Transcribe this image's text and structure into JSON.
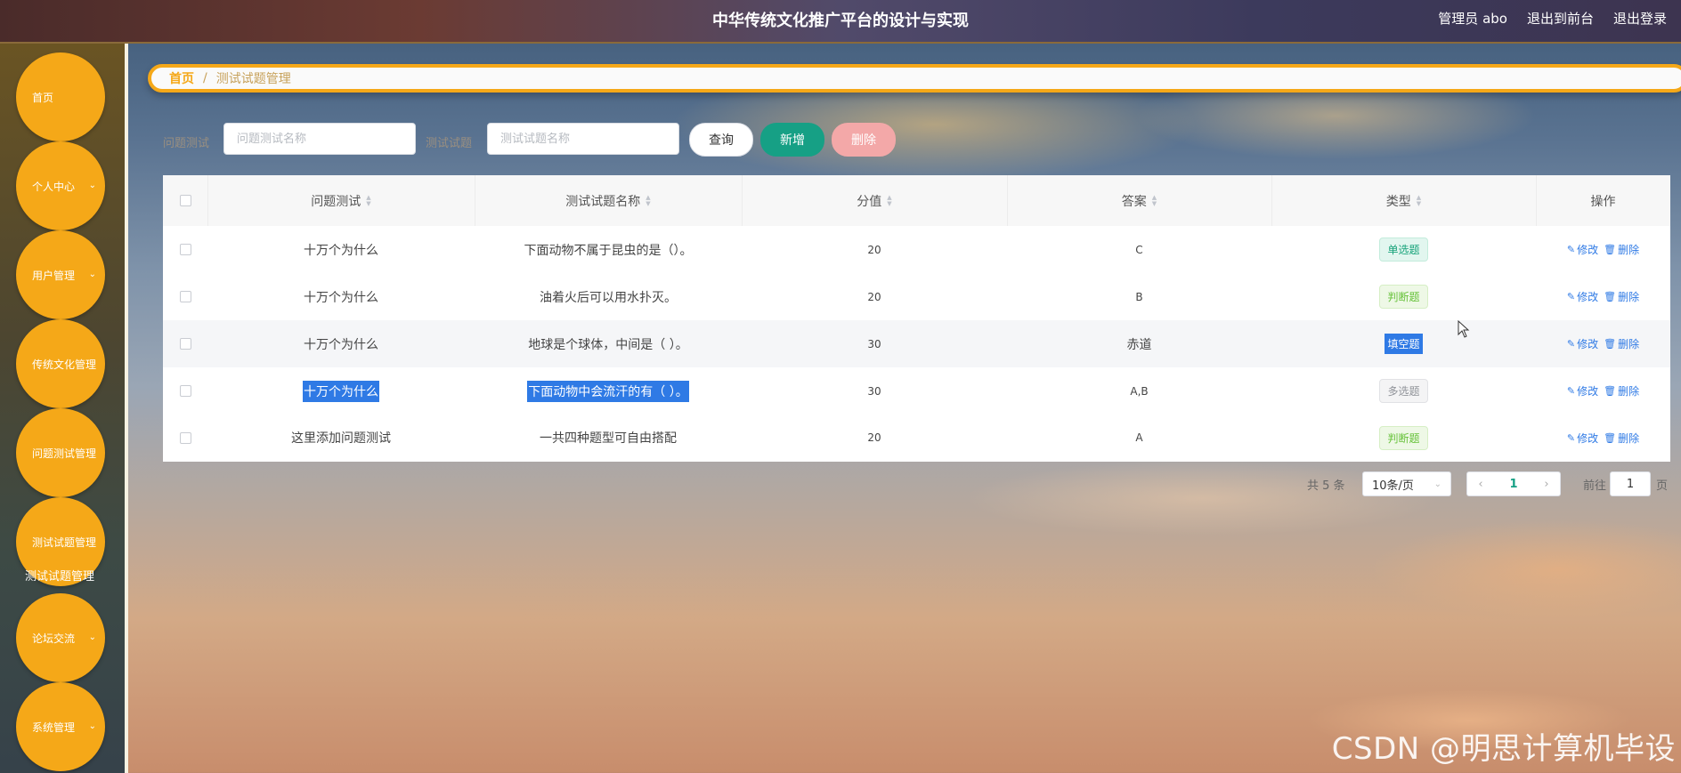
{
  "header": {
    "title": "中华传统文化推广平台的设计与实现",
    "user": "管理员 abo",
    "to_front": "退出到前台",
    "logout": "退出登录"
  },
  "sidebar": {
    "items": [
      {
        "label": "首页",
        "has_submenu": false
      },
      {
        "label": "个人中心",
        "has_submenu": true
      },
      {
        "label": "用户管理",
        "has_submenu": true
      },
      {
        "label": "传统文化管理",
        "has_submenu": false
      },
      {
        "label": "问题测试管理",
        "has_submenu": false
      },
      {
        "label": "测试试题管理",
        "has_submenu": false
      },
      {
        "label": "论坛交流",
        "has_submenu": true
      },
      {
        "label": "系统管理",
        "has_submenu": true
      }
    ],
    "floating_label": "测试试题管理"
  },
  "breadcrumb": {
    "home": "首页",
    "separator": "/",
    "current": "测试试题管理"
  },
  "search": {
    "label1": "问题测试",
    "placeholder1": "问题测试名称",
    "label2": "测试试题",
    "placeholder2": "测试试题名称",
    "query_button": "查询",
    "add_button": "新增",
    "delete_button": "删除"
  },
  "table": {
    "columns": [
      "问题测试",
      "测试试题名称",
      "分值",
      "答案",
      "类型",
      "操作"
    ],
    "rows": [
      {
        "test": "十万个为什么",
        "question": "下面动物不属于昆虫的是（）。",
        "score": "20",
        "answer": "C",
        "type": "单选题"
      },
      {
        "test": "十万个为什么",
        "question": "油着火后可以用水扑灭。",
        "score": "20",
        "answer": "B",
        "type": "判断题"
      },
      {
        "test": "十万个为什么",
        "question": "地球是个球体，中间是（ ）。",
        "score": "30",
        "answer": "赤道",
        "type": "填空题"
      },
      {
        "test": "十万个为什么",
        "question": "下面动物中会流汗的有（ ）。",
        "score": "30",
        "answer": "A,B",
        "type": "多选题"
      },
      {
        "test": "这里添加问题测试",
        "question": "一共四种题型可自由搭配",
        "score": "20",
        "answer": "A",
        "type": "判断题"
      }
    ],
    "edit_label": "修改",
    "delete_label": "删除"
  },
  "pagination": {
    "total_text": "共 5 条",
    "page_size": "10条/页",
    "current_page": "1",
    "goto_label": "前往",
    "goto_value": "1",
    "page_suffix": "页"
  },
  "watermark": "CSDN @明思计算机毕设",
  "colors": {
    "accent": "#f5a818",
    "primary_button": "#16a085",
    "delete_button": "#f3a8a8",
    "link": "#2f7ae5"
  }
}
